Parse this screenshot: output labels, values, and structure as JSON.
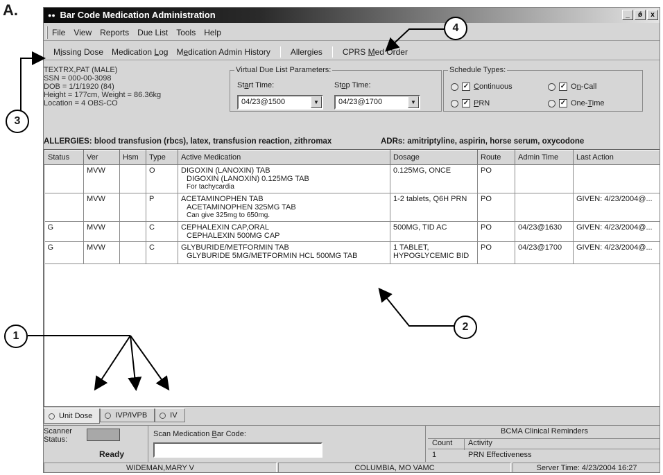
{
  "figure_label": "A.",
  "window": {
    "title": "Bar Code Medication Administration",
    "title_icon": "bcma-app-icon",
    "buttons": [
      "_",
      "ǿ",
      "x"
    ]
  },
  "menu": [
    "File",
    "View",
    "Reports",
    "Due List",
    "Tools",
    "Help"
  ],
  "toolbar": {
    "items": [
      {
        "pre": "M",
        "u": "i",
        "post": "ssing Dose"
      },
      {
        "pre": "Medication ",
        "u": "L",
        "post": "og"
      },
      {
        "pre": "M",
        "u": "e",
        "post": "dication Admin History"
      },
      {
        "pre": "Aller",
        "u": "g",
        "post": "ies"
      },
      {
        "pre": "CPRS ",
        "u": "M",
        "post": "ed Order"
      }
    ]
  },
  "patient": {
    "name": "TEXTRX,PAT  (MALE)",
    "ssn": "SSN = 000-00-3098",
    "dob": "DOB = 1/1/1920 (84)",
    "hw": "Height = 177cm, Weight = 86.36kg",
    "location": "Location = 4 OBS-CO"
  },
  "vdl": {
    "legend": "Virtual Due List Parameters:",
    "start_label_pre": "St",
    "start_label_u": "a",
    "start_label_post": "rt Time:",
    "stop_label_pre": "St",
    "stop_label_u": "o",
    "stop_label_post": "p Time:",
    "start_value": "04/23@1500",
    "stop_value": "04/23@1700"
  },
  "schedule": {
    "legend": "Schedule Types:",
    "continuous_u": "C",
    "continuous_rest": "ontinuous",
    "prn_u": "P",
    "prn_rest": "RN",
    "oncall_pre": "O",
    "oncall_u": "n",
    "oncall_post": "-Call",
    "onetime_pre": "One-",
    "onetime_u": "T",
    "onetime_post": "ime",
    "check_mark": "✓"
  },
  "allergies": {
    "text": "ALLERGIES:  blood transfusion (rbcs), latex, transfusion reaction, zithromax",
    "adrs": "ADRs:  amitriptyline, aspirin, horse serum, oxycodone"
  },
  "grid": {
    "headers": [
      "Status",
      "Ver",
      "Hsm",
      "Type",
      "Active Medication",
      "Dosage",
      "Route",
      "Admin Time",
      "Last Action"
    ],
    "rows": [
      {
        "status": "",
        "ver": "MVW",
        "hsm": "",
        "type": "O",
        "med": "DIGOXIN (LANOXIN) TAB",
        "sub": "DIGOXIN (LANOXIN) 0.125MG TAB",
        "note": "For tachycardia",
        "dosage": "0.125MG, ONCE",
        "dosage2": "",
        "route": "PO",
        "admin": "",
        "last": ""
      },
      {
        "status": "",
        "ver": "MVW",
        "hsm": "",
        "type": "P",
        "med": "ACETAMINOPHEN TAB",
        "sub": "ACETAMINOPHEN 325MG TAB",
        "note": "Can give 325mg to 650mg.",
        "dosage": "1-2 tablets, Q6H PRN",
        "dosage2": "",
        "route": "PO",
        "admin": "",
        "last": "GIVEN: 4/23/2004@..."
      },
      {
        "status": "G",
        "ver": "MVW",
        "hsm": "",
        "type": "C",
        "med": "CEPHALEXIN CAP,ORAL",
        "sub": "CEPHALEXIN 500MG CAP",
        "note": "",
        "dosage": "500MG, TID AC",
        "dosage2": "",
        "route": "PO",
        "admin": "04/23@1630",
        "last": "GIVEN: 4/23/2004@..."
      },
      {
        "status": "G",
        "ver": "MVW",
        "hsm": "",
        "type": "C",
        "med": "GLYBURIDE/METFORMIN TAB",
        "sub": "GLYBURIDE 5MG/METFORMIN HCL 500MG TAB",
        "note": "",
        "dosage": "1 TABLET,",
        "dosage2": "HYPOGLYCEMIC BID",
        "route": "PO",
        "admin": "04/23@1700",
        "last": "GIVEN: 4/23/2004@..."
      }
    ]
  },
  "tabs": [
    "Unit Dose",
    "IVP/IVPB",
    "IV"
  ],
  "bottom": {
    "scanner_label_1": "Scanner",
    "scanner_label_2": "Status:",
    "ready": "Ready",
    "scan_label_pre": "Scan Medication ",
    "scan_label_u": "B",
    "scan_label_post": "ar Code:",
    "reminders_title": "BCMA Clinical Reminders",
    "count_header": "Count",
    "activity_header": "Activity",
    "count_value": "1",
    "activity_value": "PRN Effectiveness"
  },
  "statusbar": {
    "user": "WIDEMAN,MARY V",
    "facility": "COLUMBIA, MO VAMC",
    "server_time": "Server Time: 4/23/2004 16:27"
  },
  "callouts": [
    "1",
    "2",
    "3",
    "4"
  ]
}
